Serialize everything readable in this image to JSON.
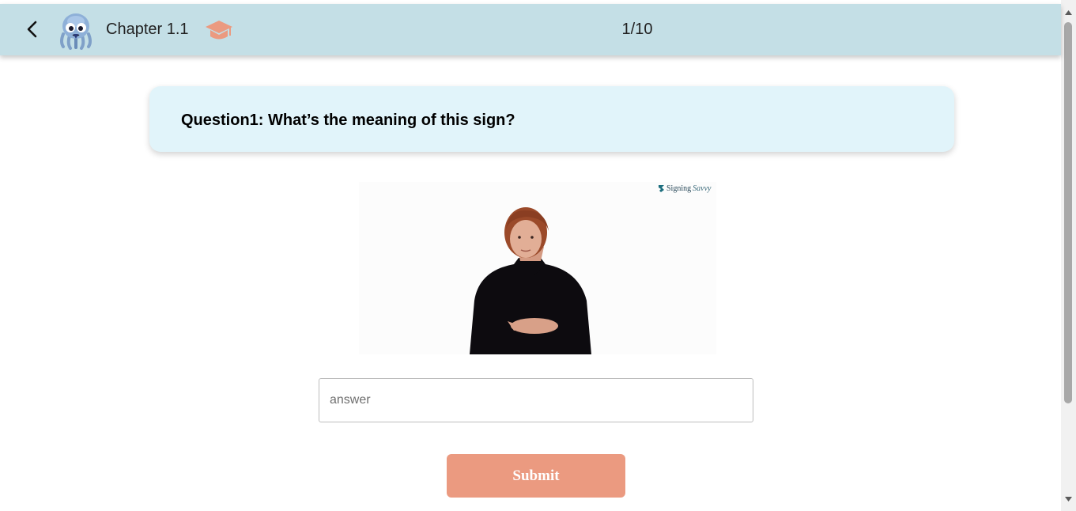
{
  "header": {
    "chapter_title": "Chapter 1.1",
    "progress": "1/10",
    "back_icon": "chevron-left-icon",
    "mascot_icon": "octopus-mascot-icon",
    "course_icon": "graduation-cap-icon"
  },
  "question": {
    "text": "Question1: What’s the meaning of this sign?"
  },
  "video": {
    "watermark_brand": "Signing",
    "watermark_script": "Savvy"
  },
  "answer": {
    "placeholder": "answer",
    "value": ""
  },
  "submit": {
    "label": "Submit"
  },
  "colors": {
    "header_bg": "#c4dfe6",
    "question_bg": "#e1f4fa",
    "accent": "#eb9a80"
  }
}
